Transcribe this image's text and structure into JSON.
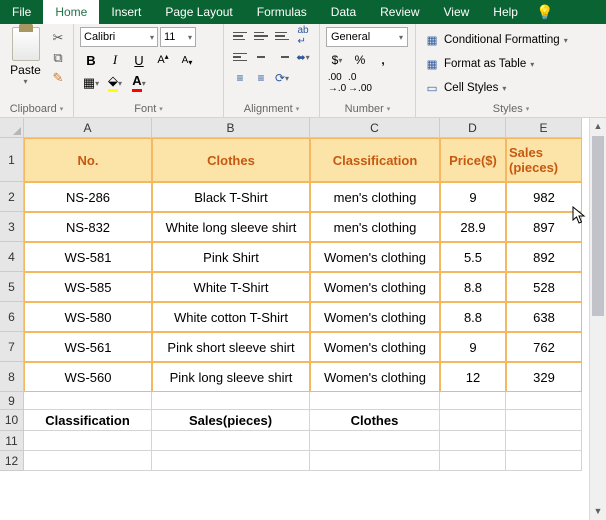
{
  "tabs": {
    "file": "File",
    "home": "Home",
    "insert": "Insert",
    "pagelayout": "Page Layout",
    "formulas": "Formulas",
    "data": "Data",
    "review": "Review",
    "view": "View",
    "help": "Help"
  },
  "ribbon": {
    "clipboard": {
      "paste": "Paste",
      "label": "Clipboard"
    },
    "font": {
      "name": "Calibri",
      "size": "11",
      "label": "Font"
    },
    "alignment": {
      "label": "Alignment"
    },
    "number": {
      "format": "General",
      "label": "Number"
    },
    "styles": {
      "cond": "Conditional Formatting",
      "table": "Format as Table",
      "cell": "Cell Styles",
      "label": "Styles"
    }
  },
  "columns": [
    "A",
    "B",
    "C",
    "D",
    "E"
  ],
  "chart_data": {
    "type": "table",
    "headers": [
      "No.",
      "Clothes",
      "Classification",
      "Price($)",
      "Sales (pieces)"
    ],
    "rows": [
      [
        "NS-286",
        "Black T-Shirt",
        "men's clothing",
        "9",
        "982"
      ],
      [
        "NS-832",
        "White long sleeve shirt",
        "men's clothing",
        "28.9",
        "897"
      ],
      [
        "WS-581",
        "Pink Shirt",
        "Women's clothing",
        "5.5",
        "892"
      ],
      [
        "WS-585",
        "White T-Shirt",
        "Women's clothing",
        "8.8",
        "528"
      ],
      [
        "WS-580",
        "White cotton T-Shirt",
        "Women's clothing",
        "8.8",
        "638"
      ],
      [
        "WS-561",
        "Pink short sleeve shirt",
        "Women's clothing",
        "9",
        "762"
      ],
      [
        "WS-560",
        "Pink long sleeve shirt",
        "Women's clothing",
        "12",
        "329"
      ]
    ]
  },
  "row10": {
    "a": "Classification",
    "b": "Sales(pieces)",
    "c": "Clothes"
  },
  "row_heights": {
    "header": 44,
    "data": 30,
    "r9": 18,
    "r10": 21,
    "blank": 20
  }
}
